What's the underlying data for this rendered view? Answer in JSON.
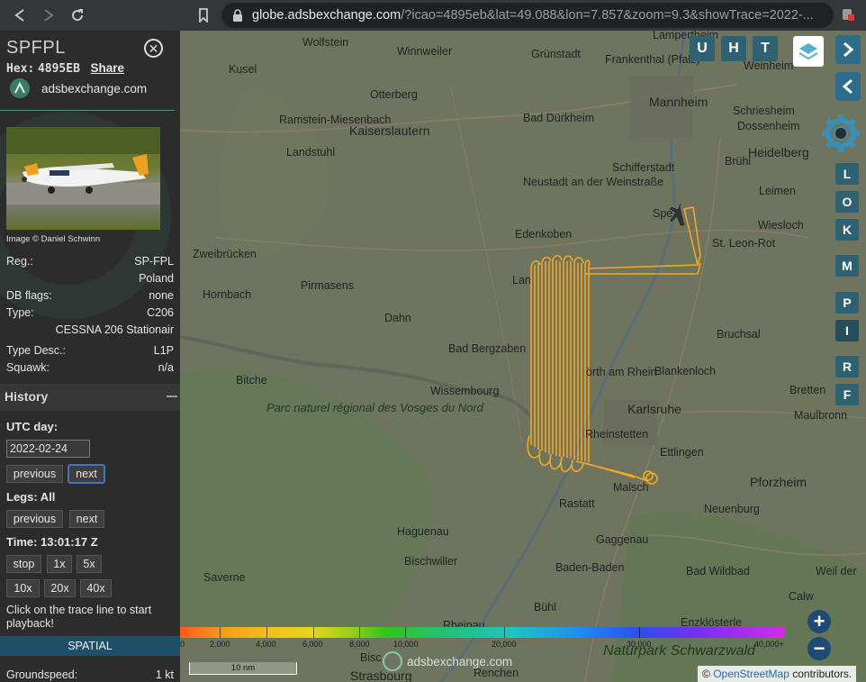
{
  "browser": {
    "url_host": "globe.adsbexchange.com",
    "url_rest": "/?icao=4895eb&lat=49.088&lon=7.857&zoom=9.3&showTrace=2022-..."
  },
  "aircraft": {
    "callsign": "SPFPL",
    "hex_label": "Hex:",
    "hex": "4895EB",
    "share_label": "Share",
    "site": "adsbexchange.com",
    "photo_credit": "Image © Daniel Schwinn",
    "reg_label": "Reg.:",
    "reg": "SP-FPL",
    "country": "Poland",
    "db_flags_label": "DB flags:",
    "db_flags": "none",
    "type_label": "Type:",
    "type": "C206",
    "type_name": "CESSNA 206 Stationair",
    "type_desc_label": "Type Desc.:",
    "type_desc": "L1P",
    "squawk_label": "Squawk:",
    "squawk": "n/a"
  },
  "history": {
    "title": "History",
    "utc_day_label": "UTC day:",
    "date": "2022-02-24",
    "previous_label": "previous",
    "next_label": "next",
    "legs_label": "Legs: All",
    "time_label": "Time: 13:01:17 Z",
    "stop_label": "stop",
    "speeds": [
      "1x",
      "5x",
      "10x",
      "20x",
      "40x"
    ],
    "hint": "Click on the trace line to start playback!"
  },
  "spatial": {
    "title": "SPATIAL",
    "groundspeed_label": "Groundspeed:",
    "groundspeed": "1 kt"
  },
  "map": {
    "places": {
      "wolfstein": "Wolfstein",
      "winnweiler": "Winnweiler",
      "grunstadt": "Grünstadt",
      "frankenthal": "Frankenthal (Pfalz)",
      "lampertheim": "Lampertheim",
      "weinheim": "Weinheim",
      "kusel": "Kusel",
      "otterberg": "Otterberg",
      "bad_durkheim": "Bad Dürkheim",
      "mannheim": "Mannheim",
      "schriesheim": "Schriesheim",
      "dossenheim": "Dossenheim",
      "ramstein": "Ramstein-Miesenbach",
      "landstuhl": "Landstuhl",
      "kaiserslautern": "Kaiserslautern",
      "heidelberg": "Heidelberg",
      "schifferstadt": "Schifferstadt",
      "bruhl": "Brühl",
      "neustadt": "Neustadt an der Weinstraße",
      "leimen": "Leimen",
      "speyer": "Spe",
      "wiesloch": "Wiesloch",
      "zweibrucken": "Zweibrücken",
      "edenkoben": "Edenkoben",
      "st_leon_rot": "St. Leon-Rot",
      "hornbach": "Hornbach",
      "pirmasens": "Pirmasens",
      "landau": "Lan",
      "dahn": "Dahn",
      "bruchsal": "Bruchsal",
      "bad_bergzabern": "Bad Bergzaben",
      "bitche": "Bitche",
      "blankenloch": "Blankenloch",
      "wissembourg": "Wissembourg",
      "worth": "örth am Rhein",
      "karlsruhe": "Karlsruhe",
      "bretten": "Bretten",
      "maulbronn": "Maulbronn",
      "rheinstetten": "Rheinstetten",
      "ettlingen": "Ettlingen",
      "pforzheim": "Pforzheim",
      "malsch": "Malsch",
      "rastatt": "Rastatt",
      "neuenburg": "Neuenburg",
      "haguenau": "Haguenau",
      "gaggenau": "Gaggenau",
      "bischwiller": "Bischwiller",
      "baden_baden": "Baden-Baden",
      "saverne": "Saverne",
      "bad_wildbad": "Bad Wildbad",
      "weil_der_stadt": "Weil der",
      "buhl": "Bühl",
      "calw": "Calw",
      "enzklosterle": "Enzklösterle",
      "rheinau": "Rheinau",
      "strasbourg": "Strasbourg",
      "renchen": "Renchen",
      "bisch": "Bisc",
      "park_vosges": "Parc naturel régional des Vosges du Nord",
      "park_schwarzwald": "Naturpark Schwarzwald"
    },
    "buttons": [
      "U",
      "H",
      "T"
    ],
    "side_buttons": [
      "L",
      "O",
      "K",
      "M",
      "P",
      "I",
      "R",
      "F"
    ],
    "altitude_labels": [
      "0",
      "2,000",
      "4,000",
      "6,000",
      "8,000",
      "10,000",
      "20,000",
      "30,000",
      "40,000+"
    ],
    "scale": "10 nm",
    "logo_text": "adsbexchange.com",
    "attribution_prefix": "© ",
    "attribution_link": "OpenStreetMap",
    "attribution_suffix": " contributors.",
    "trace_color": "#f5a623"
  }
}
